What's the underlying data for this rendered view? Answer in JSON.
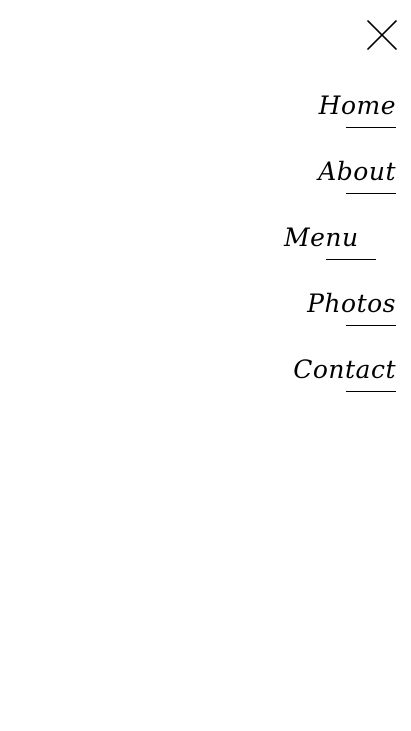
{
  "close_button": {
    "icon": "close-icon"
  },
  "nav": {
    "items": [
      {
        "label": "Home"
      },
      {
        "label": "About"
      },
      {
        "label": "Menu"
      },
      {
        "label": "Photos"
      },
      {
        "label": "Contact"
      }
    ]
  }
}
